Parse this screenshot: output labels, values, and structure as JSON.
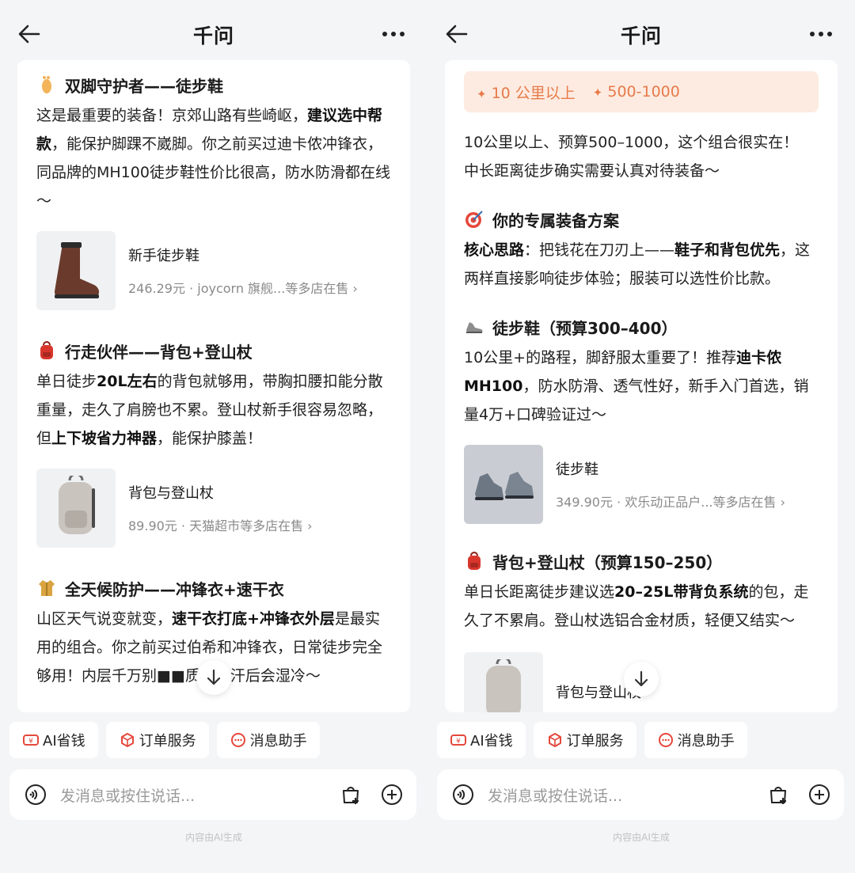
{
  "left": {
    "title": "千问",
    "sections": [
      {
        "heading": "双脚守护者——徒步鞋",
        "text_parts": [
          {
            "t": "这是最重要的装备！京郊山路有些崎岖，",
            "b": false
          },
          {
            "t": "建议选中帮款",
            "b": true
          },
          {
            "t": "，能保护脚踝不崴脚。你之前买过迪卡侬冲锋衣，同品牌的MH100徒步鞋性价比很高，防水防滑都在线～",
            "b": false
          }
        ],
        "product": {
          "name": "新手徒步鞋",
          "meta": "246.29元 · joycorn 旗舰...等多店在售 ›"
        }
      },
      {
        "heading": "行走伙伴——背包+登山杖",
        "text_parts": [
          {
            "t": "单日徒步",
            "b": false
          },
          {
            "t": "20L左右",
            "b": true
          },
          {
            "t": "的背包就够用，带胸扣腰扣能分散重量，走久了肩膀也不累。登山杖新手很容易忽略，但",
            "b": false
          },
          {
            "t": "上下坡省力神器",
            "b": true
          },
          {
            "t": "，能保护膝盖！",
            "b": false
          }
        ],
        "product": {
          "name": "背包与登山杖",
          "meta": "89.90元 · 天猫超市等多店在售 ›"
        }
      },
      {
        "heading": "全天候防护——冲锋衣+速干衣",
        "text_parts": [
          {
            "t": "山区天气说变就变，",
            "b": false
          },
          {
            "t": "速干衣打底+冲锋衣外层",
            "b": true
          },
          {
            "t": "是最实用的组合。你之前买过伯希和冲锋衣，日常徒步完全够用！内层千万别■■质，出汗后会湿冷～",
            "b": false
          }
        ]
      }
    ]
  },
  "right": {
    "title": "千问",
    "tags": [
      "10 公里以上",
      "500-1000"
    ],
    "intro_lines": [
      "10公里以上、预算500–1000，这个组合很实在！",
      "中长距离徒步确实需要认真对待装备～"
    ],
    "plan_heading": "你的专属装备方案",
    "plan_parts": [
      {
        "t": "核心思路",
        "b": true
      },
      {
        "t": "：把钱花在刀刃上——",
        "b": false
      },
      {
        "t": "鞋子和背包优先",
        "b": true
      },
      {
        "t": "，这两样直接影响徒步体验；服装可以选性价比款。",
        "b": false
      }
    ],
    "shoe_heading": "徒步鞋（预算300–400）",
    "shoe_parts": [
      {
        "t": "10公里+的路程，脚舒服太重要了！推荐",
        "b": false
      },
      {
        "t": "迪卡侬MH100",
        "b": true
      },
      {
        "t": "，防水防滑、透气性好，新手入门首选，销量4万+口碑验证过～",
        "b": false
      }
    ],
    "shoe_product": {
      "name": "徒步鞋",
      "meta": "349.90元 · 欢乐动正品户...等多店在售 ›"
    },
    "bag_heading": "背包+登山杖（预算150–250）",
    "bag_parts": [
      {
        "t": "单日长距离徒步建议选",
        "b": false
      },
      {
        "t": "20–25L带背负系统",
        "b": true
      },
      {
        "t": "的包，走久了不累肩。登山杖选铝合金材质，轻便又结实～",
        "b": false
      }
    ],
    "bag_product": {
      "name": "背包与登山杖"
    }
  },
  "chips": [
    "AI省钱",
    "订单服务",
    "消息助手"
  ],
  "input_placeholder": "发消息或按住说话...",
  "footer_note": "内容由AI生成",
  "colors": {
    "accent_orange": "#e77a4a",
    "tag_bg": "#fdebe1",
    "chip_red": "#e5483b"
  }
}
